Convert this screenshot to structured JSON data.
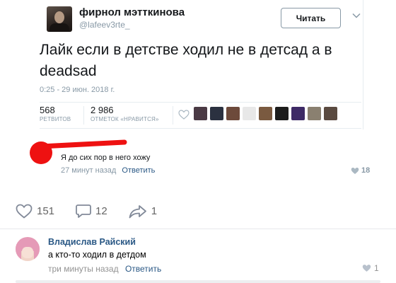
{
  "tweet": {
    "author_name": "фирнол мэтткинова",
    "author_handle": "@lafeev3rte_",
    "follow_label": "Читать",
    "text": "Лайк если в детстве ходил не в детсад а в deadsad",
    "date": "0:25 - 29 июн. 2018 г.",
    "retweets_count": "568",
    "retweets_label": "РЕТВИТОВ",
    "likes_count": "2 986",
    "likes_label": "ОТМЕТОК «НРАВИТСЯ»",
    "liker_colors": [
      "#4a3a44",
      "#2b3140",
      "#6d4a3b",
      "#e8e8e8",
      "#7a5a40",
      "#1c1c1c",
      "#3d2a66",
      "#8a8070",
      "#5a4a40"
    ],
    "reply": {
      "text": "Я до сих пор в него хожу",
      "time": "27 минут назад",
      "reply_label": "Ответить",
      "likes": "18"
    }
  },
  "post_actions": {
    "likes": "151",
    "comments": "12",
    "shares": "1"
  },
  "comment": {
    "author": "Владислав Райский",
    "text": "а кто-то ходил в детдом",
    "time": "три минуты назад",
    "reply_label": "Ответить",
    "likes": "1"
  },
  "colors": {
    "link": "#2a5885",
    "muted": "#939393",
    "red": "#ee1111"
  }
}
